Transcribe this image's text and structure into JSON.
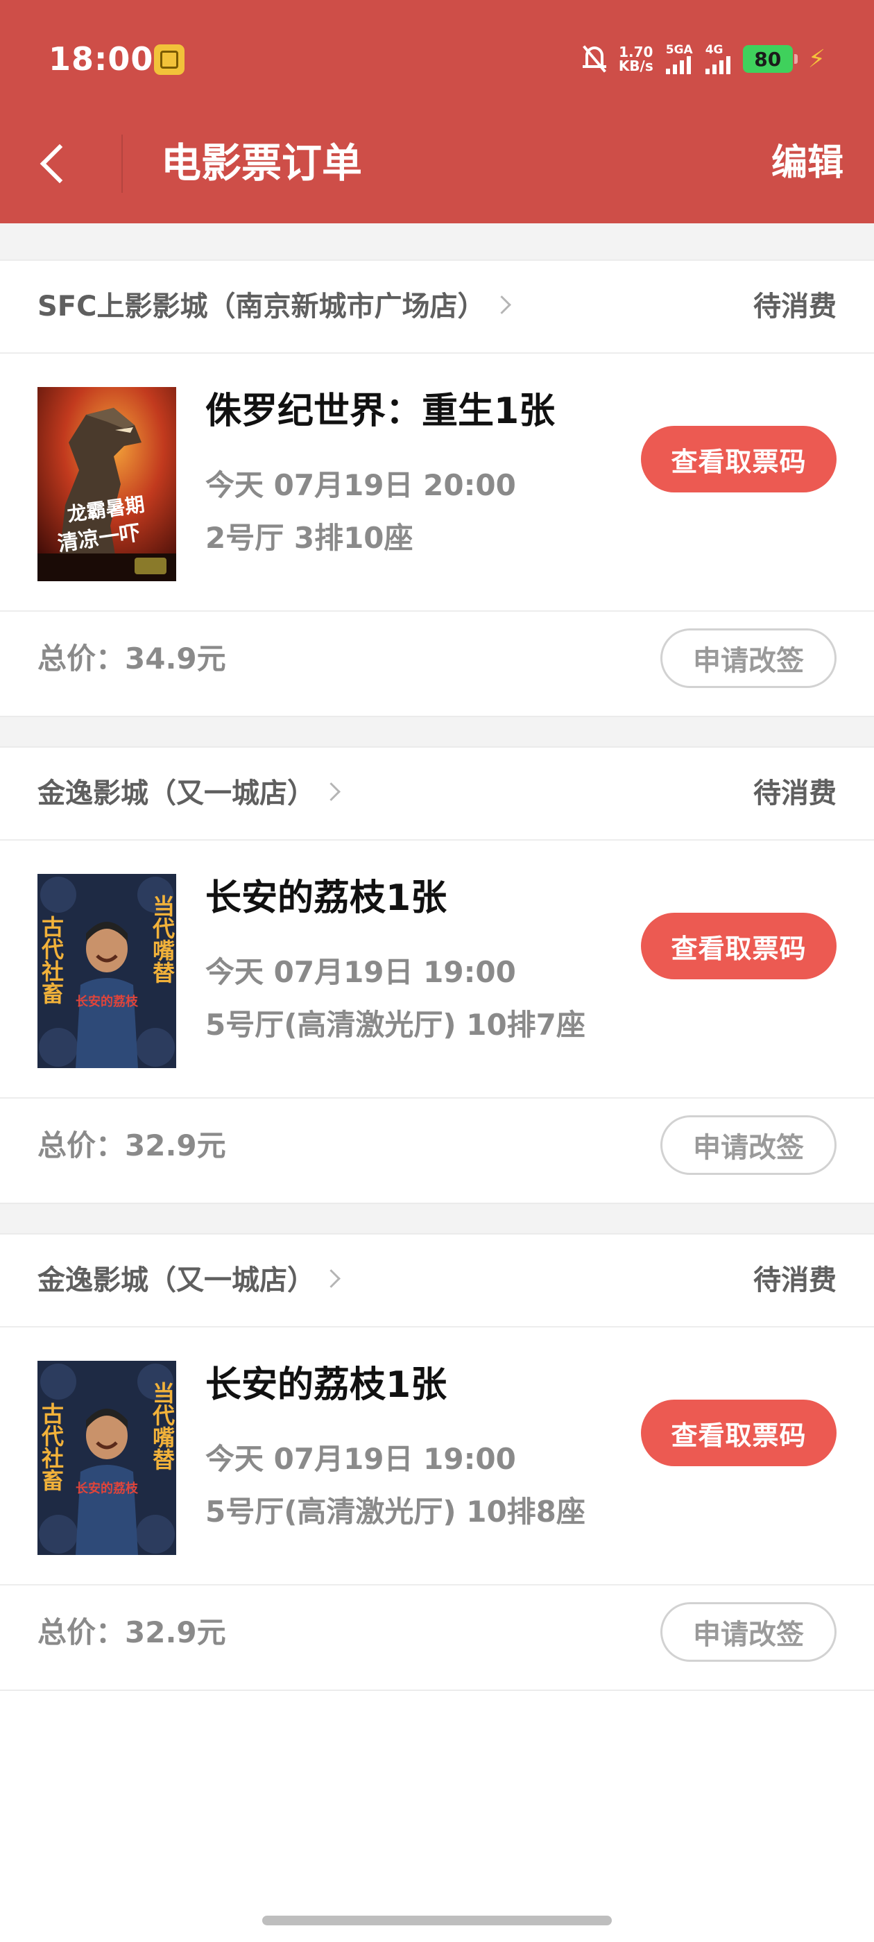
{
  "status_bar": {
    "time": "18:00",
    "net_speed_value": "1.70",
    "net_speed_unit": "KB/s",
    "signal_1_label": "5GA",
    "signal_2_label": "4G",
    "battery": "80"
  },
  "header": {
    "title": "电影票订单",
    "edit_label": "编辑"
  },
  "orders": [
    {
      "cinema": "SFC上影影城（南京新城市广场店）",
      "status": "待消费",
      "movie": "侏罗纪世界：重生1张",
      "showtime": "今天 07月19日 20:00",
      "seat": "2号厅 3排10座",
      "ticket_button": "查看取票码",
      "total": "总价：34.9元",
      "change_button": "申请改签",
      "poster_text": {
        "line1": "龙霸暑期",
        "line2": "清凉一吓"
      }
    },
    {
      "cinema": "金逸影城（又一城店）",
      "status": "待消费",
      "movie": "长安的荔枝1张",
      "showtime": "今天 07月19日 19:00",
      "seat": "5号厅(高清激光厅) 10排7座",
      "ticket_button": "查看取票码",
      "total": "总价：32.9元",
      "change_button": "申请改签",
      "poster_text": {
        "left": "古代社畜",
        "right": "当代嘴替",
        "center": "长安的荔枝"
      }
    },
    {
      "cinema": "金逸影城（又一城店）",
      "status": "待消费",
      "movie": "长安的荔枝1张",
      "showtime": "今天 07月19日 19:00",
      "seat": "5号厅(高清激光厅) 10排8座",
      "ticket_button": "查看取票码",
      "total": "总价：32.9元",
      "change_button": "申请改签",
      "poster_text": {
        "left": "古代社畜",
        "right": "当代嘴替",
        "center": "长安的荔枝"
      }
    }
  ],
  "colors": {
    "header_bg": "#CE4E48",
    "primary_button": "#EC5A52",
    "battery": "#3FD15C"
  }
}
